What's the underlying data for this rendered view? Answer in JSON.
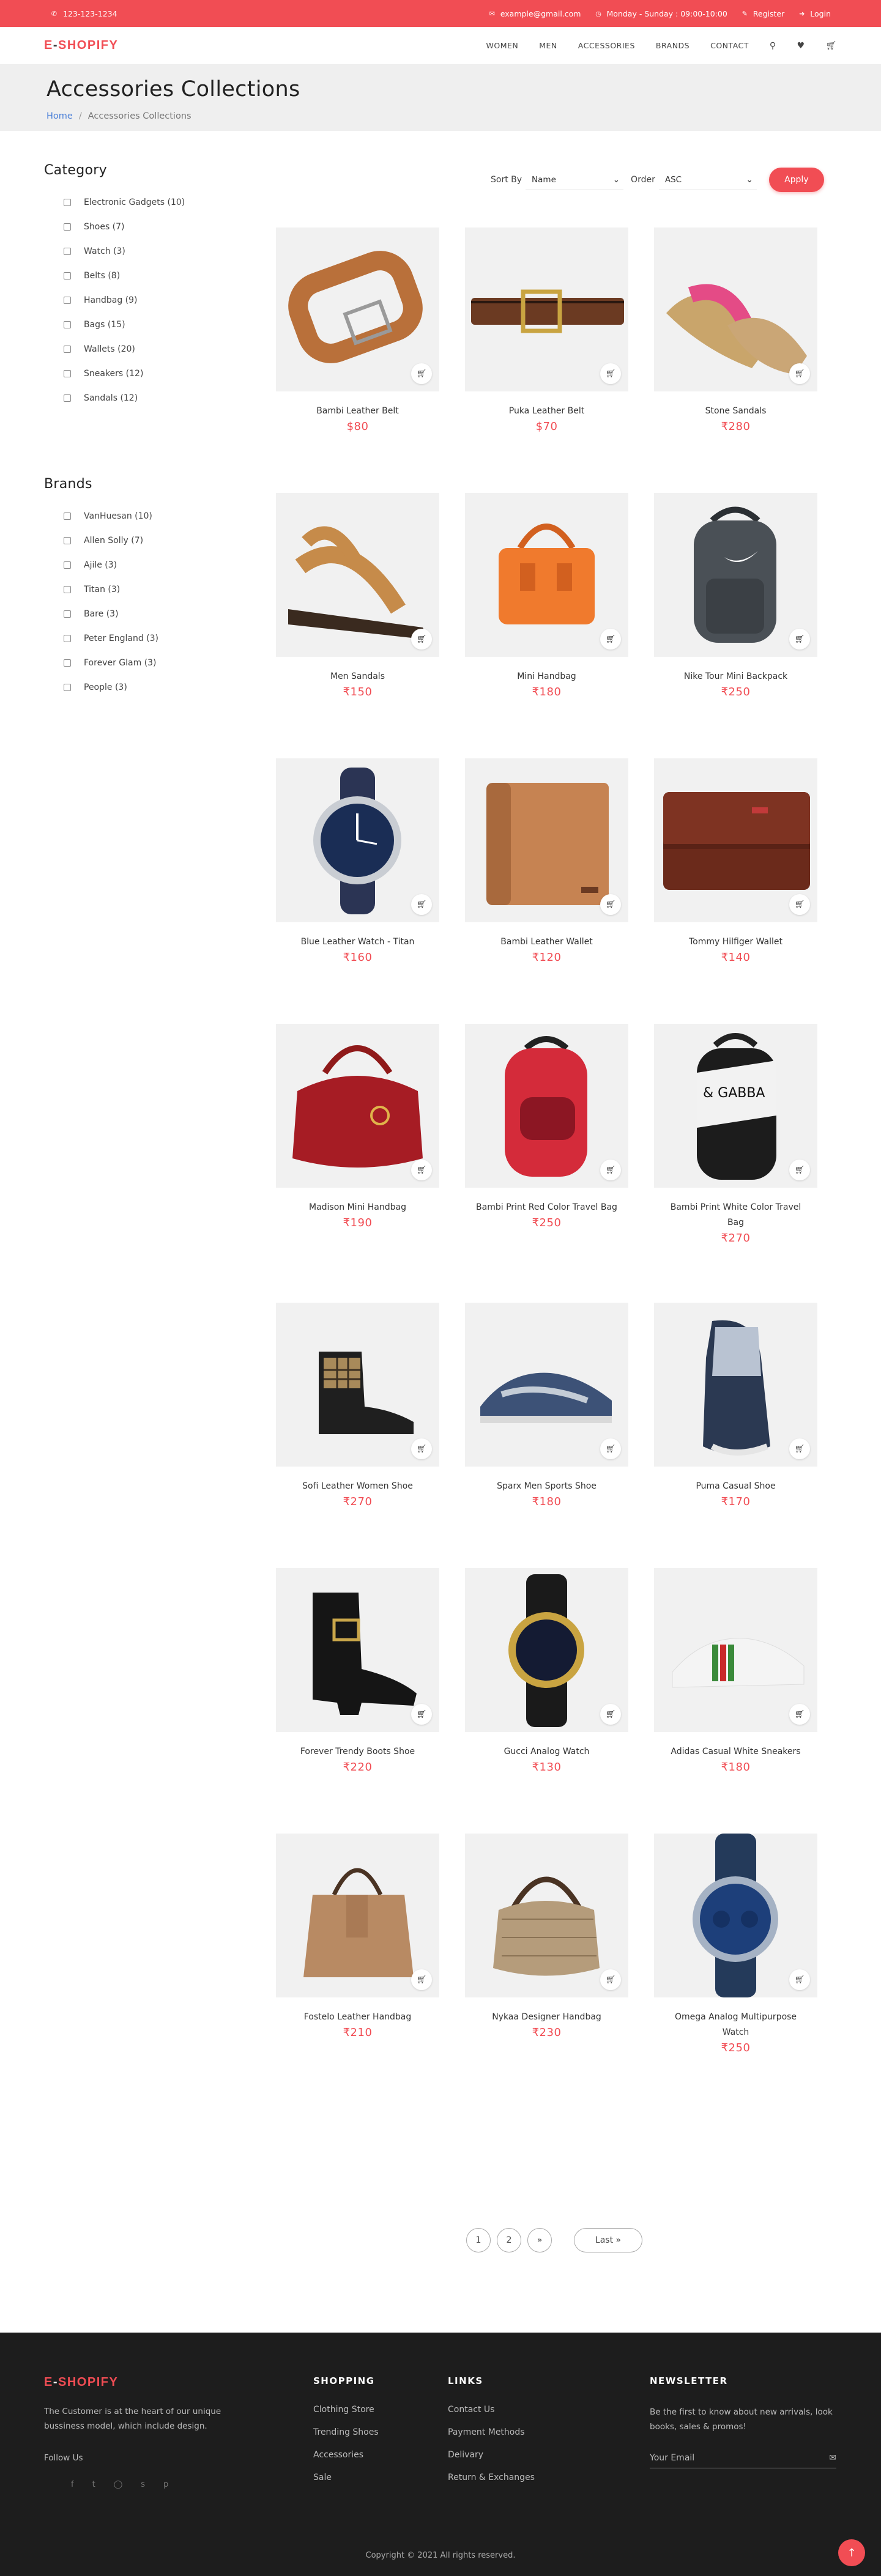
{
  "topbar": {
    "phone": "123-123-1234",
    "email": "example@gmail.com",
    "hours": "Monday - Sunday : 09:00-10:00",
    "register": "Register",
    "login": "Login"
  },
  "nav": {
    "logo_e": "E",
    "logo_dash": "-",
    "logo_rest": "SHOPIFY",
    "items": [
      "WOMEN",
      "MEN",
      "ACCESSORIES",
      "BRANDS",
      "CONTACT"
    ],
    "icons": [
      "search-icon",
      "heart-icon",
      "cart-icon"
    ]
  },
  "hero": {
    "title": "Accessories Collections",
    "crumb_home": "Home",
    "crumb_sep": "/",
    "crumb_current": "Accessories Collections"
  },
  "sidebar": {
    "category_title": "Category",
    "categories": [
      "Electronic Gadgets (10)",
      "Shoes (7)",
      "Watch (3)",
      "Belts (8)",
      "Handbag (9)",
      "Bags (15)",
      "Wallets (20)",
      "Sneakers (12)",
      "Sandals (12)"
    ],
    "brands_title": "Brands",
    "brands": [
      "VanHuesan (10)",
      "Allen Solly (7)",
      "Ajile (3)",
      "Titan (3)",
      "Bare (3)",
      "Peter England (3)",
      "Forever Glam (3)",
      "People (3)"
    ]
  },
  "sort": {
    "sort_by_label": "Sort By",
    "sort_by_value": "Name",
    "order_label": "Order",
    "order_value": "ASC",
    "apply": "Apply"
  },
  "products": [
    {
      "name": "Bambi Leather Belt",
      "price": "$80",
      "art": "belt-brown"
    },
    {
      "name": "Puka Leather Belt",
      "price": "$70",
      "art": "belt-dark"
    },
    {
      "name": "Stone Sandals",
      "price": "₹280",
      "art": "sandal-pink"
    },
    {
      "name": "Men Sandals",
      "price": "₹150",
      "art": "sandal-tan"
    },
    {
      "name": "Mini Handbag",
      "price": "₹180",
      "art": "bag-orange"
    },
    {
      "name": "Nike Tour Mini Backpack",
      "price": "₹250",
      "art": "backpack-gray"
    },
    {
      "name": "Blue Leather Watch - Titan",
      "price": "₹160",
      "art": "watch-blue"
    },
    {
      "name": "Bambi Leather Wallet",
      "price": "₹120",
      "art": "wallet-tan"
    },
    {
      "name": "Tommy Hilfiger Wallet",
      "price": "₹140",
      "art": "wallet-brown"
    },
    {
      "name": "Madison Mini Handbag",
      "price": "₹190",
      "art": "bag-red"
    },
    {
      "name": "Bambi Print Red Color Travel Bag",
      "price": "₹250",
      "art": "backpack-red"
    },
    {
      "name": "Bambi Print White Color Travel Bag",
      "price": "₹270",
      "art": "backpack-white"
    },
    {
      "name": "Sofi Leather Women Shoe",
      "price": "₹270",
      "art": "boot-check"
    },
    {
      "name": "Sparx Men Sports Shoe",
      "price": "₹180",
      "art": "shoe-sport"
    },
    {
      "name": "Puma Casual Shoe",
      "price": "₹170",
      "art": "shoe-puma"
    },
    {
      "name": "Forever Trendy Boots Shoe",
      "price": "₹220",
      "art": "boot-black"
    },
    {
      "name": "Gucci Analog Watch",
      "price": "₹130",
      "art": "watch-gold"
    },
    {
      "name": "Adidas Casual White Sneakers",
      "price": "₹180",
      "art": "sneaker-white"
    },
    {
      "name": "Fostelo Leather Handbag",
      "price": "₹210",
      "art": "bag-camel"
    },
    {
      "name": "Nykaa Designer Handbag",
      "price": "₹230",
      "art": "bag-hobo"
    },
    {
      "name": "Omega Analog Multipurpose Watch",
      "price": "₹250",
      "art": "watch-omega"
    }
  ],
  "pager": {
    "pages": [
      "1",
      "2"
    ],
    "next": "»",
    "last": "Last »"
  },
  "footer": {
    "logo_e": "E",
    "logo_dash": "-",
    "logo_rest": "SHOPIFY",
    "about": "The Customer is at the heart of our unique bussiness model, which include design.",
    "follow": "Follow Us",
    "socials": [
      "facebook-icon",
      "twitter-icon",
      "instagram-icon",
      "skype-icon",
      "pinterest-icon"
    ],
    "shopping_title": "SHOPPING",
    "shopping": [
      "Clothing Store",
      "Trending Shoes",
      "Accessories",
      "Sale"
    ],
    "links_title": "LINKS",
    "links": [
      "Contact Us",
      "Payment Methods",
      "Delivary",
      "Return & Exchanges"
    ],
    "newsletter_title": "NEWSLETTER",
    "newsletter_text": "Be the first to know about new arrivals, look books, sales & promos!",
    "email_placeholder": "Your Email",
    "copyright": "Copyright © 2021 All rights reserved."
  }
}
